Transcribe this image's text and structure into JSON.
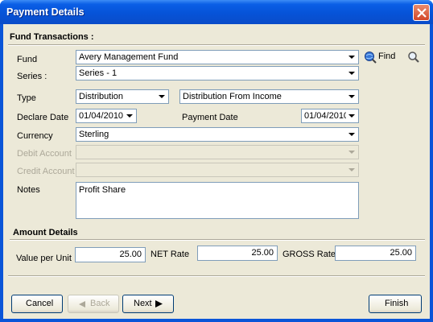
{
  "window": {
    "title": "Payment Details"
  },
  "section_fund": {
    "heading": "Fund Transactions :"
  },
  "fund": {
    "label": "Fund",
    "value": "Avery Management Fund",
    "find_label": "Find"
  },
  "series": {
    "label": "Series :",
    "value": "Series - 1"
  },
  "type": {
    "label": "Type",
    "value": "Distribution",
    "sub_value": "Distribution From Income"
  },
  "declare_date": {
    "label": "Declare Date",
    "value": "01/04/2010"
  },
  "payment_date": {
    "label": "Payment Date",
    "value": "01/04/2010"
  },
  "currency": {
    "label": "Currency",
    "value": "Sterling"
  },
  "debit_account": {
    "label": "Debit Account",
    "value": ""
  },
  "credit_account": {
    "label": "Credit Account",
    "value": ""
  },
  "notes": {
    "label": "Notes",
    "value": "Profit Share"
  },
  "section_amount": {
    "heading": "Amount Details"
  },
  "value_per_unit": {
    "label": "Value per Unit",
    "value": "25.00"
  },
  "net_rate": {
    "label": "NET Rate",
    "value": "25.00"
  },
  "gross_rate": {
    "label": "GROSS Rate",
    "value": "25.00"
  },
  "buttons": {
    "cancel": "Cancel",
    "back": "Back",
    "next": "Next",
    "finish": "Finish"
  }
}
